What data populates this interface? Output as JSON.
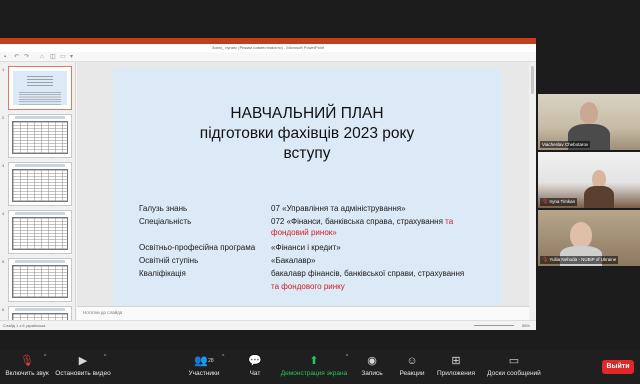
{
  "powerpoint": {
    "window_title": "Зовні_ луганс (Режим совместимости) - Microsoft PowerPoint",
    "slide_numbers": [
      "1",
      "2",
      "3",
      "4",
      "5",
      "6"
    ],
    "notes_placeholder": "Нотатки до слайда",
    "status_left": "Слайд 1 з 6   українська",
    "status_zoom": "58%",
    "slide": {
      "title_line1": "НАВЧАЛЬНИЙ ПЛАН",
      "title_line2": "підготовки фахівців 2023 року",
      "title_line3": "вступу",
      "rows": [
        {
          "label": "Галузь знань",
          "value": "07 «Управління та адміністрування»",
          "value_red": ""
        },
        {
          "label": "Спеціальність",
          "value": "072 «Фінанси, банківська справа, страхування ",
          "value_red": "та"
        },
        {
          "label": "",
          "value": "",
          "value_red": "фондовий ринок»"
        },
        {
          "label": "Освітньо-професійна програма",
          "value": "«Фінанси і кредит»",
          "value_red": ""
        },
        {
          "label": "Освітній ступінь",
          "value": "«Бакалавр»",
          "value_red": ""
        },
        {
          "label": "Кваліфікація",
          "value": "бакалавр фінансів, банківської справи, страхування",
          "value_red": ""
        },
        {
          "label": "",
          "value": "",
          "value_red": "та фондового ринку"
        }
      ]
    }
  },
  "participants": [
    {
      "name": "Viacheslav Chebotarov",
      "muted": false
    },
    {
      "name": "Iryna Timkan",
      "muted": true
    },
    {
      "name": "Yuliia Nehoda - NUBiP of Ukraine",
      "muted": true
    }
  ],
  "controls": {
    "mute": "Включить звук",
    "video": "Остановить видео",
    "participants": "Участники",
    "participants_count": "28",
    "chat": "Чат",
    "share": "Демонстрация экрана",
    "record": "Запись",
    "reactions": "Реакции",
    "apps": "Приложения",
    "whiteboards": "Доски сообщений",
    "leave": "Выйти"
  }
}
